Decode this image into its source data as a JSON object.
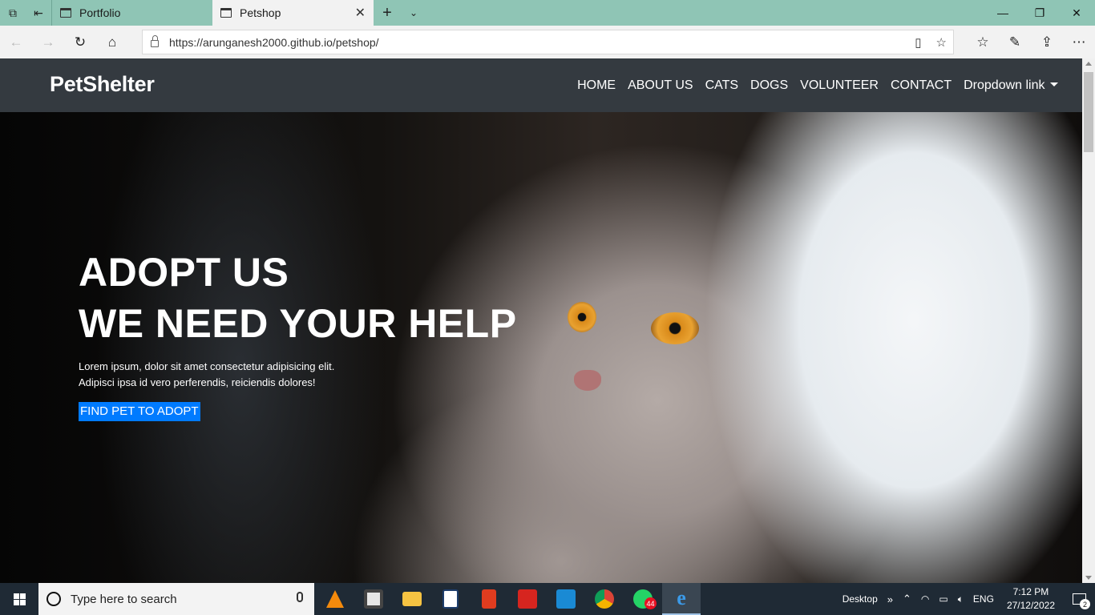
{
  "browser": {
    "tabs": [
      {
        "title": "Portfolio",
        "active": false
      },
      {
        "title": "Petshop",
        "active": true
      }
    ],
    "new_tab_glyph": "+",
    "url": "https://arunganesh2000.github.io/petshop/"
  },
  "site": {
    "brand": "PetShelter",
    "menu": [
      {
        "label": "HOME"
      },
      {
        "label": "ABOUT US"
      },
      {
        "label": "CATS"
      },
      {
        "label": "DOGS"
      },
      {
        "label": "VOLUNTEER"
      },
      {
        "label": "CONTACT"
      },
      {
        "label": "Dropdown link"
      }
    ],
    "hero": {
      "title_line1": "ADOPT US",
      "title_line2": "WE NEED YOUR HELP",
      "text_line1": "Lorem ipsum, dolor sit amet consectetur adipisicing elit.",
      "text_line2": "Adipisci ipsa id vero perferendis, reiciendis dolores!",
      "button": "FIND PET TO ADOPT"
    }
  },
  "taskbar": {
    "search_placeholder": "Type here to search",
    "whatsapp_badge": "44",
    "desktop_label": "Desktop",
    "language": "ENG",
    "time": "7:12 PM",
    "date": "27/12/2022",
    "notifications": "2"
  },
  "colors": {
    "tabbar": "#8fc5b5",
    "navbar": "#343a40",
    "primary_button": "#007bff",
    "taskbar": "#1f2a35"
  }
}
